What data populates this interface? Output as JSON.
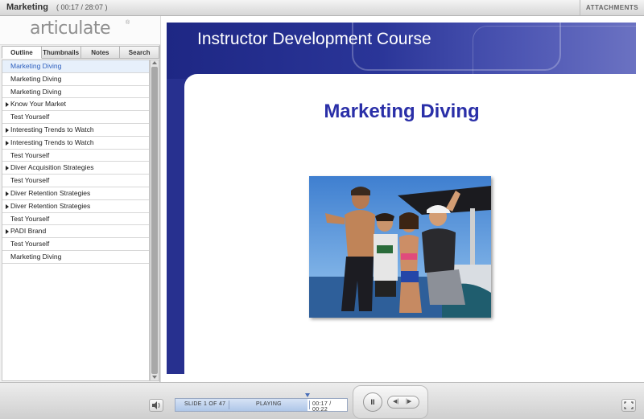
{
  "titlebar": {
    "title": "Marketing",
    "time": "( 00:17 / 28:07 )",
    "attachments": "ATTACHMENTS"
  },
  "sidebar": {
    "logo": "articulate",
    "logo_mark": "®",
    "tabs": [
      "Outline",
      "Thumbnails",
      "Notes",
      "Search"
    ],
    "items": [
      {
        "label": "Marketing Diving",
        "expandable": false,
        "selected": true
      },
      {
        "label": "Marketing Diving",
        "expandable": false
      },
      {
        "label": "Marketing Diving",
        "expandable": false
      },
      {
        "label": "Know Your Market",
        "expandable": true
      },
      {
        "label": "Test Yourself",
        "expandable": false
      },
      {
        "label": "Interesting Trends to Watch",
        "expandable": true
      },
      {
        "label": "Interesting Trends to Watch",
        "expandable": true
      },
      {
        "label": "Test Yourself",
        "expandable": false
      },
      {
        "label": "Diver Acquisition Strategies",
        "expandable": true
      },
      {
        "label": "Test Yourself",
        "expandable": false
      },
      {
        "label": "Diver Retention Strategies",
        "expandable": true
      },
      {
        "label": "Diver Retention Strategies",
        "expandable": true
      },
      {
        "label": "Test Yourself",
        "expandable": false
      },
      {
        "label": "PADI Brand",
        "expandable": true
      },
      {
        "label": "Test Yourself",
        "expandable": false
      },
      {
        "label": "Marketing Diving",
        "expandable": false
      }
    ]
  },
  "slide": {
    "course_title": "Instructor Development Course",
    "heading": "Marketing Diving",
    "colors": {
      "band": "#27308f",
      "heading": "#2a2fa8"
    }
  },
  "controls": {
    "slide_label": "SLIDE 1 OF 47",
    "status": "PLAYING",
    "elapsed": "00:17 / 00:22",
    "progress": 0.77,
    "pause_label": "II",
    "prev_label": "◀|",
    "next_label": "|▶"
  },
  "icons": {
    "volume": "speaker-icon",
    "fullscreen": "fullscreen-icon"
  }
}
